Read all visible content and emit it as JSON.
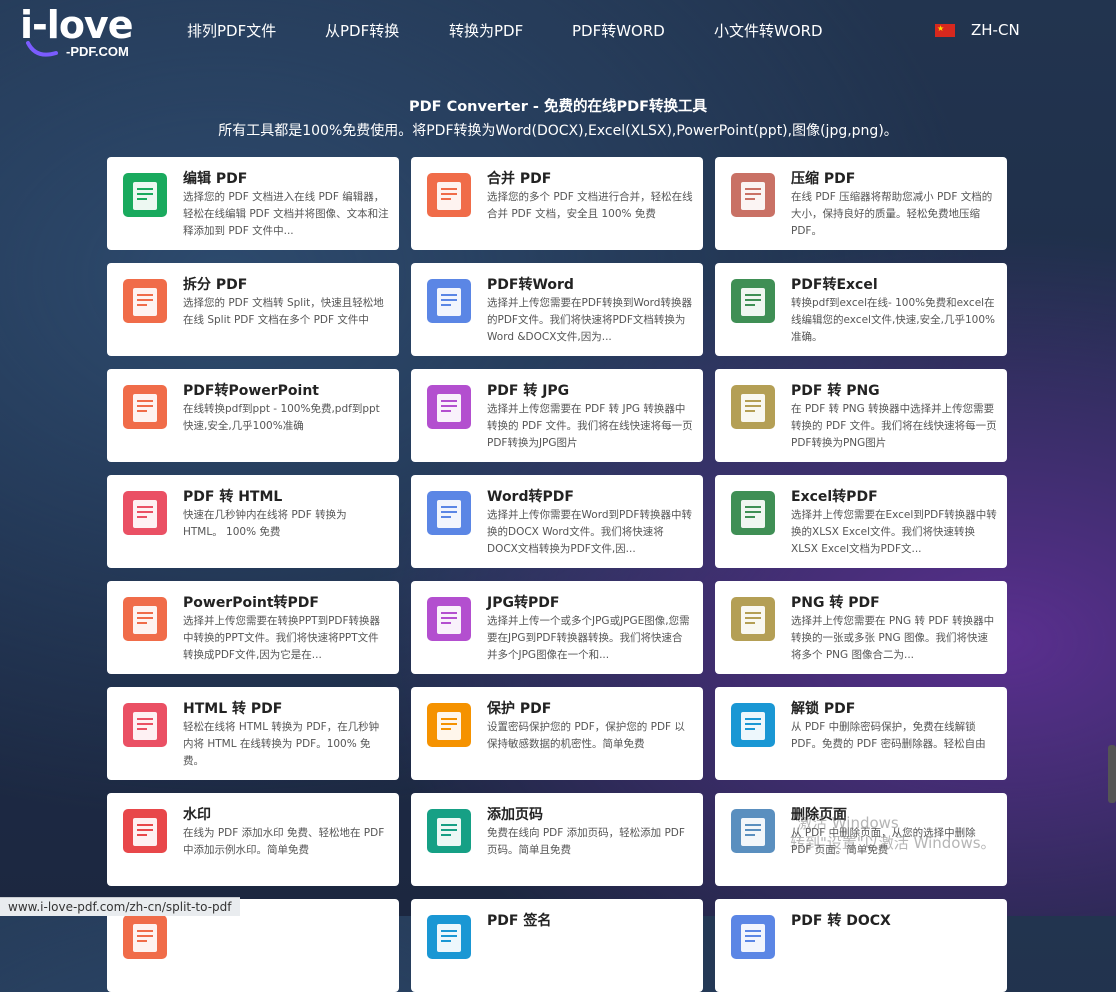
{
  "header": {
    "logo_main": "i-love",
    "logo_sub": "-PDF.COM",
    "nav": [
      {
        "label": "排列PDF文件"
      },
      {
        "label": "从PDF转换"
      },
      {
        "label": "转换为PDF"
      },
      {
        "label": "PDF转WORD"
      },
      {
        "label": "小文件转WORD"
      }
    ],
    "language": "ZH-CN"
  },
  "hero": {
    "title": "PDF Converter - 免费的在线PDF转换工具",
    "subtitle": "所有工具都是100%免费使用。将PDF转换为Word(DOCX),Excel(XLSX),PowerPoint(ppt),图像(jpg,png)。"
  },
  "tools": [
    {
      "title": "编辑 PDF",
      "desc": "选择您的 PDF 文档进入在线 PDF 编辑器，轻松在线编辑 PDF 文档并将图像、文本和注释添加到 PDF 文件中...",
      "icon": "edit-pdf-icon",
      "color": "#1aaa5e"
    },
    {
      "title": "合并 PDF",
      "desc": "选择您的多个 PDF 文档进行合并，轻松在线合并 PDF 文档，安全且 100% 免费",
      "icon": "merge-pdf-icon",
      "color": "#f06c49"
    },
    {
      "title": "压缩 PDF",
      "desc": "在线 PDF 压缩器将帮助您减小 PDF 文档的大小，保持良好的质量。轻松免费地压缩 PDF。",
      "icon": "compress-pdf-icon",
      "color": "#c97165"
    },
    {
      "title": "拆分 PDF",
      "desc": "选择您的 PDF 文档转 Split，快速且轻松地在线 Split PDF 文档在多个 PDF 文件中",
      "icon": "split-pdf-icon",
      "color": "#f06c49"
    },
    {
      "title": "PDF转Word",
      "desc": "选择并上传您需要在PDF转换到Word转换器的PDF文件。我们将快速将PDF文档转换为Word &DOCX文件,因为...",
      "icon": "pdf-to-word-icon",
      "color": "#5b86e5"
    },
    {
      "title": "PDF转Excel",
      "desc": "转换pdf到excel在线- 100%免费和excel在线编辑您的excel文件,快速,安全,几乎100%准确。",
      "icon": "pdf-to-excel-icon",
      "color": "#3f8f55"
    },
    {
      "title": "PDF转PowerPoint",
      "desc": "在线转换pdf到ppt - 100%免费,pdf到ppt快速,安全,几乎100%准确",
      "icon": "pdf-to-powerpoint-icon",
      "color": "#f06c49"
    },
    {
      "title": "PDF 转 JPG",
      "desc": "选择并上传您需要在 PDF 转 JPG 转换器中转换的 PDF 文件。我们将在线快速将每一页PDF转换为JPG图片",
      "icon": "pdf-to-jpg-icon",
      "color": "#b34fcf"
    },
    {
      "title": "PDF 转 PNG",
      "desc": "在 PDF 转 PNG 转换器中选择并上传您需要转换的 PDF 文件。我们将在线快速将每一页PDF转换为PNG图片",
      "icon": "pdf-to-png-icon",
      "color": "#b49f55"
    },
    {
      "title": "PDF 转 HTML",
      "desc": "快速在几秒钟内在线将 PDF 转换为 HTML。 100% 免费",
      "icon": "pdf-to-html-icon",
      "color": "#ea5064"
    },
    {
      "title": "Word转PDF",
      "desc": "选择并上传你需要在Word到PDF转换器中转换的DOCX Word文件。我们将快速将DOCX文档转换为PDF文件,因...",
      "icon": "word-to-pdf-icon",
      "color": "#5b86e5"
    },
    {
      "title": "Excel转PDF",
      "desc": "选择并上传您需要在Excel到PDF转换器中转换的XLSX Excel文件。我们将快速转换XLSX Excel文档为PDF文...",
      "icon": "excel-to-pdf-icon",
      "color": "#3f8f55"
    },
    {
      "title": "PowerPoint转PDF",
      "desc": "选择并上传您需要在转换PPT到PDF转换器中转换的PPT文件。我们将快速将PPT文件转换成PDF文件,因为它是在...",
      "icon": "powerpoint-to-pdf-icon",
      "color": "#f06c49"
    },
    {
      "title": "JPG转PDF",
      "desc": "选择并上传一个或多个JPG或JPGE图像,您需要在JPG到PDF转换器转换。我们将快速合并多个JPG图像在一个和...",
      "icon": "jpg-to-pdf-icon",
      "color": "#b34fcf"
    },
    {
      "title": "PNG 转 PDF",
      "desc": "选择并上传您需要在 PNG 转 PDF 转换器中转换的一张或多张 PNG 图像。我们将快速将多个 PNG 图像合二为...",
      "icon": "png-to-pdf-icon",
      "color": "#b49f55"
    },
    {
      "title": "HTML 转 PDF",
      "desc": "轻松在线将 HTML 转换为 PDF，在几秒钟内将 HTML 在线转换为 PDF。100% 免费。",
      "icon": "html-to-pdf-icon",
      "color": "#ea5064"
    },
    {
      "title": "保护 PDF",
      "desc": "设置密码保护您的 PDF，保护您的 PDF 以保持敏感数据的机密性。简单免费",
      "icon": "protect-pdf-icon",
      "color": "#f59200"
    },
    {
      "title": "解锁 PDF",
      "desc": "从 PDF 中删除密码保护，免费在线解锁 PDF。免费的 PDF 密码删除器。轻松自由",
      "icon": "unlock-pdf-icon",
      "color": "#1a97d4"
    },
    {
      "title": "水印",
      "desc": "在线为 PDF 添加水印 免费、轻松地在 PDF 中添加示例水印。简单免费",
      "icon": "watermark-icon",
      "color": "#e8474a"
    },
    {
      "title": "添加页码",
      "desc": "免费在线向 PDF 添加页码，轻松添加 PDF 页码。简单且免费",
      "icon": "page-number-icon",
      "color": "#16a085"
    },
    {
      "title": "删除页面",
      "desc": "从 PDF 中删除页面，从您的选择中删除 PDF 页面。简单免费",
      "icon": "delete-pages-icon",
      "color": "#5a8fbf"
    },
    {
      "title": "",
      "desc": "",
      "icon": "partial-tool-icon",
      "color": "#f06c49"
    },
    {
      "title": "PDF 签名",
      "desc": "",
      "icon": "sign-pdf-icon",
      "color": "#1a97d4"
    },
    {
      "title": "PDF 转 DOCX",
      "desc": "",
      "icon": "pdf-to-docx-icon",
      "color": "#5b86e5"
    }
  ],
  "status_bar": {
    "url": "www.i-love-pdf.com/zh-cn/split-to-pdf"
  },
  "os_watermark": {
    "line1": "激活 Windows",
    "line2": "转到\"设置\"以激活 Windows。"
  }
}
